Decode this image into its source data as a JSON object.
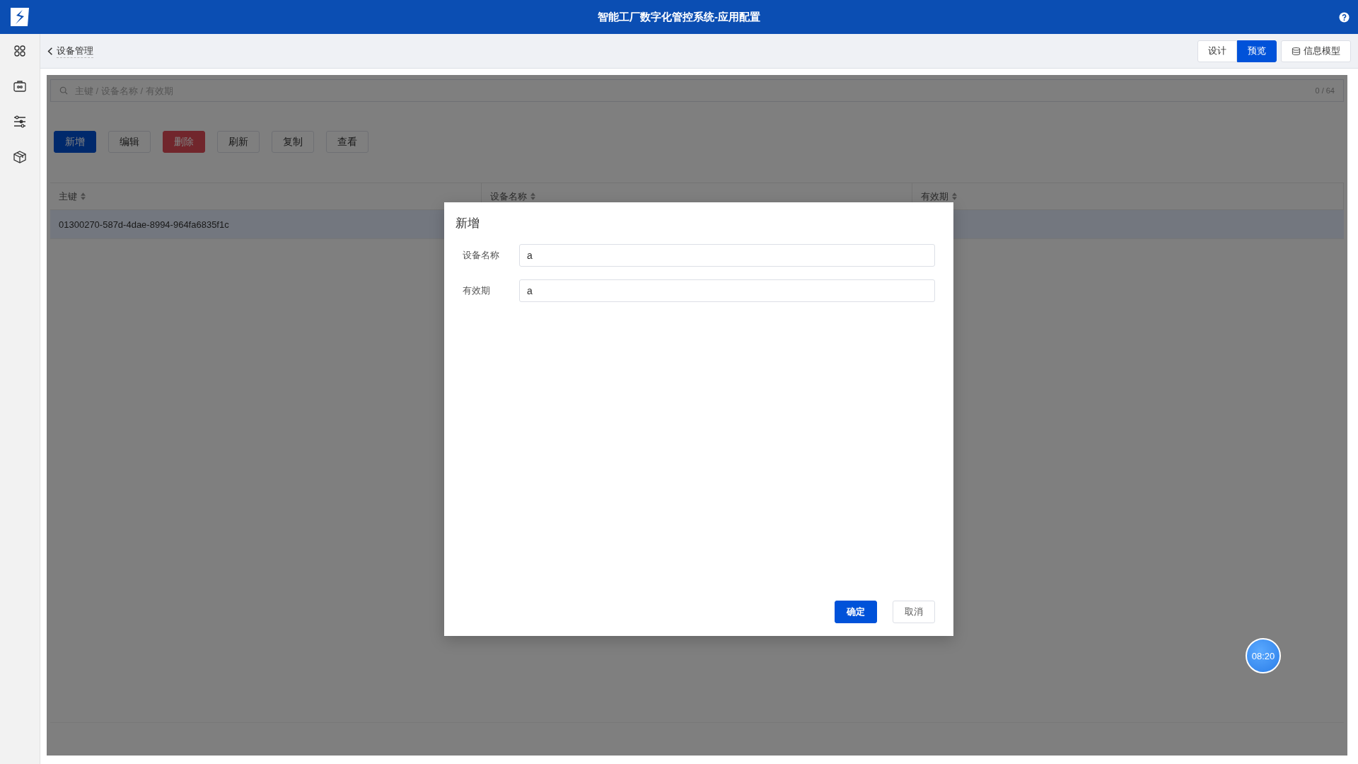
{
  "header": {
    "title": "智能工厂数字化管控系统-应用配置"
  },
  "breadcrumb": {
    "label": "设备管理"
  },
  "view_tabs": [
    {
      "label": "设计",
      "selected": false
    },
    {
      "label": "预览",
      "selected": true
    }
  ],
  "model_button": {
    "label": "信息模型"
  },
  "search": {
    "placeholder": "主键 / 设备名称 / 有效期",
    "count": "0 / 64"
  },
  "toolbar": [
    {
      "label": "新增",
      "kind": "primary"
    },
    {
      "label": "编辑",
      "kind": "default"
    },
    {
      "label": "删除",
      "kind": "danger"
    },
    {
      "label": "刷新",
      "kind": "default"
    },
    {
      "label": "复制",
      "kind": "default"
    },
    {
      "label": "查看",
      "kind": "default"
    }
  ],
  "table": {
    "columns": [
      "主键",
      "设备名称",
      "有效期"
    ],
    "rows": [
      {
        "cells": [
          "01300270-587d-4dae-8994-964fa6835f1c"
        ],
        "selected": true
      }
    ]
  },
  "dialog": {
    "title": "新增",
    "fields": [
      {
        "label": "设备名称",
        "value": "a"
      },
      {
        "label": "有效期",
        "value": "a"
      }
    ],
    "buttons": [
      {
        "label": "确定",
        "kind": "primary"
      },
      {
        "label": "取消",
        "kind": "default"
      }
    ]
  },
  "timer": {
    "time": "08:20"
  }
}
